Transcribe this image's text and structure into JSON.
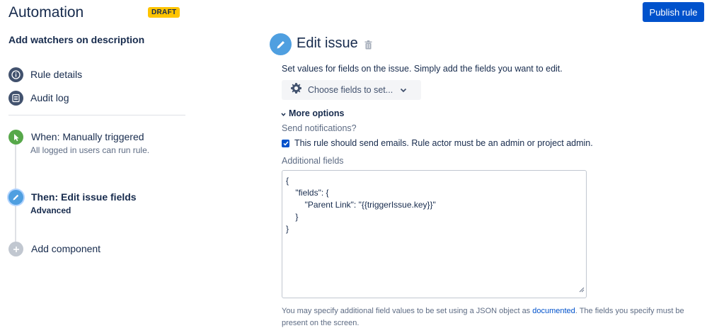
{
  "header": {
    "title": "Automation",
    "badge": "DRAFT",
    "publish_label": "Publish rule"
  },
  "sidebar": {
    "rule_name": "Add watchers on description",
    "links": [
      {
        "label": "Rule details",
        "icon": "info-icon"
      },
      {
        "label": "Audit log",
        "icon": "list-icon"
      }
    ],
    "steps": [
      {
        "title": "When: Manually triggered",
        "subtitle": "All logged in users can run rule.",
        "icon": "pointer-icon",
        "color": "#57a84a"
      },
      {
        "title": "Then: Edit issue fields",
        "subtitle": "Advanced",
        "icon": "pencil-icon",
        "color": "#4f9fe0"
      },
      {
        "title": "Add component",
        "icon": "plus-icon",
        "color": "#c1c7d0"
      }
    ]
  },
  "main": {
    "title": "Edit issue",
    "description": "Set values for fields on the issue. Simply add the fields you want to edit.",
    "choose_fields_label": "Choose fields to set...",
    "more_options_label": "More options",
    "notifications_label": "Send notifications?",
    "notifications_checkbox_label": "This rule should send emails. Rule actor must be an admin or project admin.",
    "notifications_checked": true,
    "additional_fields_label": "Additional fields",
    "additional_fields_value": "{\n    \"fields\": {\n        \"Parent Link\": \"{{triggerIssue.key}}\"\n    }\n}",
    "help_text_before": "You may specify additional field values to be set using a JSON object as ",
    "help_link": "documented",
    "help_text_after": ". The fields you specify must be present on the screen."
  },
  "colors": {
    "primary": "#0052cc",
    "draft": "#ffc400",
    "text": "#172b4d",
    "muted": "#5e6c84"
  }
}
